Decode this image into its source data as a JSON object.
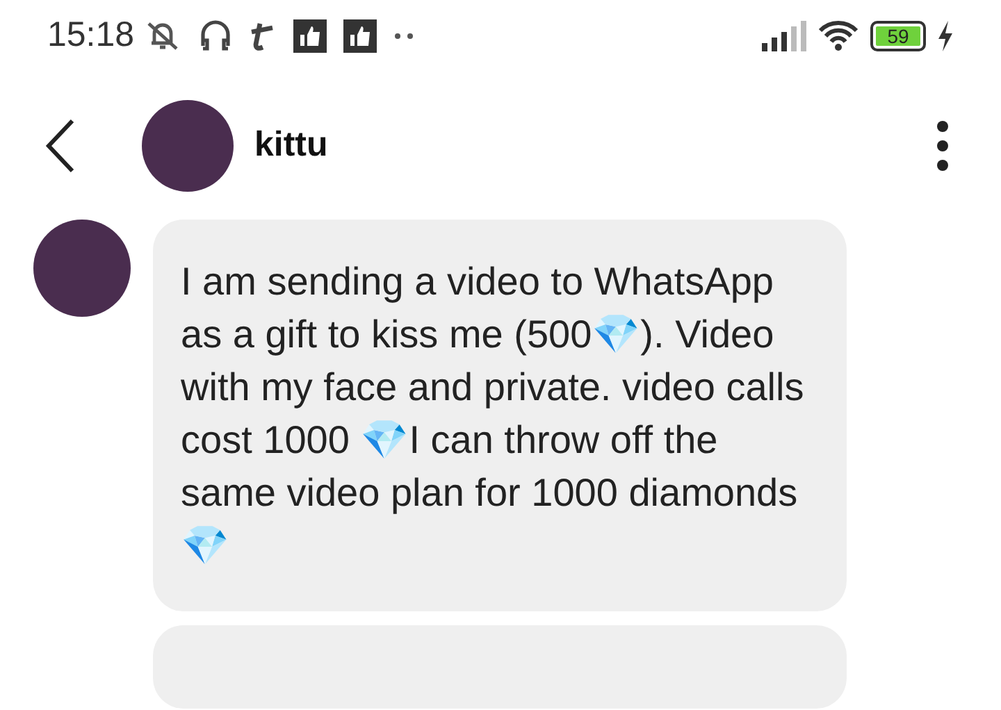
{
  "status_bar": {
    "time": "15:18",
    "battery": "59"
  },
  "header": {
    "name": "kittu"
  },
  "messages": [
    {
      "text": "I am sending a video to WhatsApp as a gift to kiss me (500💎). Video with my face and private.  video calls cost 1000 💎I can throw off the same video plan for 1000 diamonds 💎"
    }
  ]
}
